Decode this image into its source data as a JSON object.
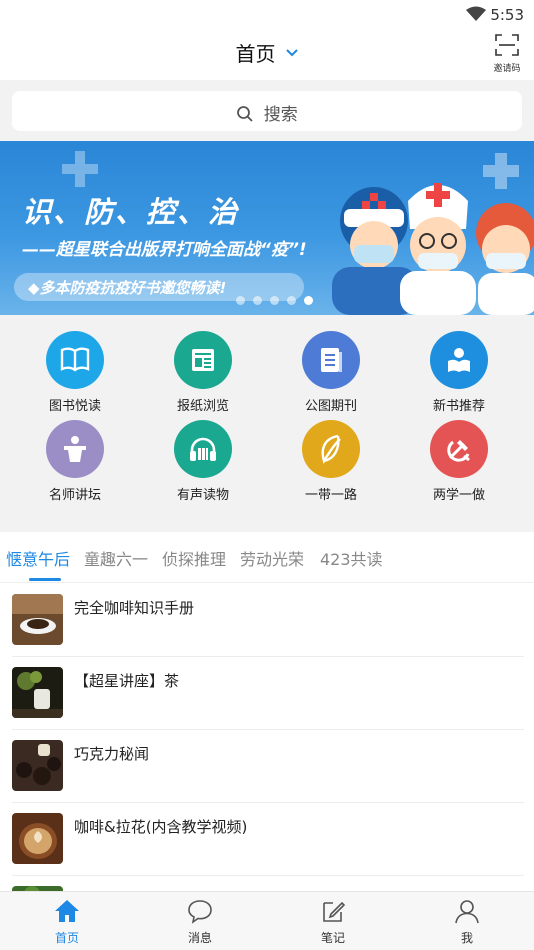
{
  "status_bar": {
    "time": "5:53"
  },
  "header": {
    "title": "首页",
    "invite_label": "邀请码"
  },
  "search": {
    "placeholder": "搜索"
  },
  "banner": {
    "title": "识、防、控、治",
    "subtitle": "——超星联合出版界打响全面战“疫”!",
    "strip": "◆多本防疫抗疫好书邀您畅读!",
    "slide_count": 5,
    "active_slide": 4
  },
  "grid": {
    "items": [
      {
        "label": "图书悦读",
        "color": "#1ea7e8",
        "icon": "book-icon"
      },
      {
        "label": "报纸浏览",
        "color": "#1aa891",
        "icon": "newspaper-icon"
      },
      {
        "label": "公图期刊",
        "color": "#4e7bd6",
        "icon": "journal-icon"
      },
      {
        "label": "新书推荐",
        "color": "#1e8fde",
        "icon": "reader-icon"
      },
      {
        "label": "名师讲坛",
        "color": "#9b8ec7",
        "icon": "podium-icon"
      },
      {
        "label": "有声读物",
        "color": "#1aa891",
        "icon": "headphones-icon"
      },
      {
        "label": "一带一路",
        "color": "#e1a81b",
        "icon": "leaf-icon"
      },
      {
        "label": "两学一做",
        "color": "#e55454",
        "icon": "party-emblem-icon"
      }
    ]
  },
  "tabs": {
    "items": [
      "惬意午后",
      "童趣六一",
      "侦探推理",
      "劳动光荣",
      "423共读"
    ],
    "active": 0
  },
  "list": {
    "items": [
      {
        "title": "完全咖啡知识手册"
      },
      {
        "title": "【超星讲座】茶"
      },
      {
        "title": "巧克力秘闻"
      },
      {
        "title": "咖啡&拉花(内含教学视频)"
      }
    ]
  },
  "tabbar": {
    "items": [
      {
        "label": "首页",
        "icon": "home-icon"
      },
      {
        "label": "消息",
        "icon": "message-icon"
      },
      {
        "label": "笔记",
        "icon": "note-icon"
      },
      {
        "label": "我",
        "icon": "person-icon"
      }
    ],
    "active": 0
  },
  "colors": {
    "accent": "#1e88e5"
  }
}
